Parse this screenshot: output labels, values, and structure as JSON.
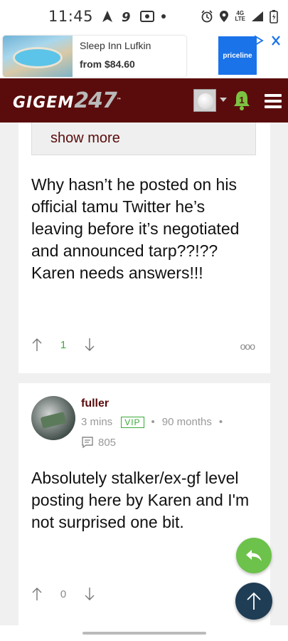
{
  "status_bar": {
    "time": "11:45",
    "network_label_top": "4G",
    "network_label_bottom": "LTE"
  },
  "ad": {
    "title": "Sleep Inn Lufkin",
    "price": "from $84.60",
    "advertiser": "priceline"
  },
  "header": {
    "logo_text": "GIGEM",
    "logo_number": "247",
    "logo_tm": "™",
    "notification_count": "1"
  },
  "posts": [
    {
      "show_more_label": "show more",
      "text": "Why hasn’t he posted on his official tamu Twitter he’s leaving before it’s negotiated and announced tarp??!?? Karen needs answers!!!",
      "votes": "1",
      "more_label": "ooo"
    },
    {
      "username": "fuller",
      "time_ago": "3 mins",
      "badge": "VIP",
      "member_since": "90 months",
      "separator": "•",
      "post_count": "805",
      "text": "Absolutely stalker/ex-gf level posting here by Karen and I'm not surprised one bit.",
      "votes": "0"
    }
  ],
  "colors": {
    "brand_maroon": "#5a0c0c",
    "upvote_green": "#3aaa3a",
    "reply_fab": "#6cc24a",
    "top_fab": "#1f3d55"
  }
}
